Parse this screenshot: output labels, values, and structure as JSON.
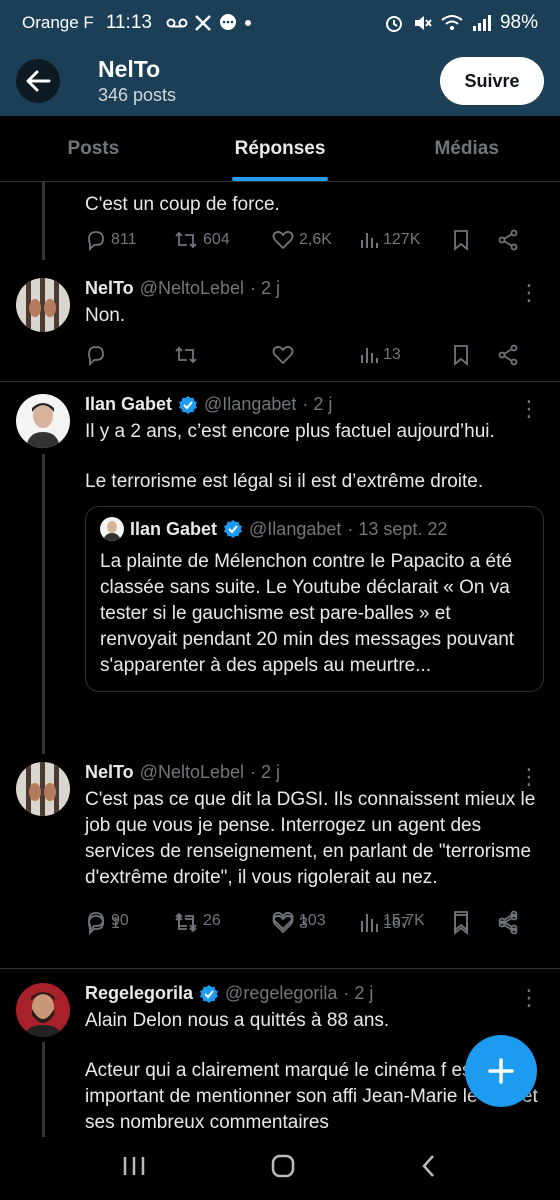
{
  "status_bar": {
    "carrier": "Orange F",
    "time": "11:13",
    "battery": "98%"
  },
  "header": {
    "title": "NelTo",
    "subtitle": "346 posts",
    "follow_label": "Suivre"
  },
  "tabs": [
    {
      "label": "Posts",
      "active": false
    },
    {
      "label": "Réponses",
      "active": true
    },
    {
      "label": "Médias",
      "active": false
    }
  ],
  "posts": [
    {
      "text": "C'est un coup de force.",
      "replies": "811",
      "reposts": "604",
      "likes": "2,6K",
      "views": "127K"
    },
    {
      "name": "NelTo",
      "handle": "@NeltoLebel",
      "time": "· 2 j",
      "text": "Non.",
      "replies": "",
      "reposts": "",
      "likes": "",
      "views": "13"
    },
    {
      "name": "Ilan Gabet",
      "handle": "@Ilangabet",
      "time": "· 2 j",
      "verified": true,
      "text1": "Il y a 2 ans, c’est encore plus factuel aujourd’hui.",
      "text2": "Le terrorisme est légal si il est d’extrême droite.",
      "quote": {
        "name": "Ilan Gabet",
        "handle": "@Ilangabet",
        "time": "· 13 sept. 22",
        "text": "La plainte de Mélenchon contre le Papacito a été classée sans suite. Le Youtube déclarait « On va tester si le gauchisme est pare-balles » et renvoyait pendant 20 min des messages pouvant s'apparenter à des appels au meurtre..."
      },
      "replies": "90",
      "reposts": "26",
      "likes": "103",
      "views": "15,7K"
    },
    {
      "name": "NelTo",
      "handle": "@NeltoLebel",
      "time": "· 2 j",
      "text": "C'est pas ce que dit la DGSI. Ils connaissent mieux le job que vous je pense. Interrogez un agent des services de renseignement, en parlant de \"terrorisme d'extrême droite\", il vous rigolerait au nez.",
      "replies": "1",
      "reposts": "",
      "likes": "3",
      "views": "167"
    },
    {
      "name": "Regelegorila",
      "handle": "@regelegorila",
      "time": "· 2 j",
      "verified": true,
      "text1": "Alain Delon nous a quittés à 88 ans.",
      "text2": "Acteur qui a clairement marqué le cinéma f est aussi important de mentionner son affi Jean-Marie le Pen et ses nombreux commentaires"
    }
  ],
  "colors": {
    "header_bg": "#1b3f57",
    "accent": "#1d9bf0",
    "muted": "#71767b",
    "text": "#e7e9ea"
  }
}
